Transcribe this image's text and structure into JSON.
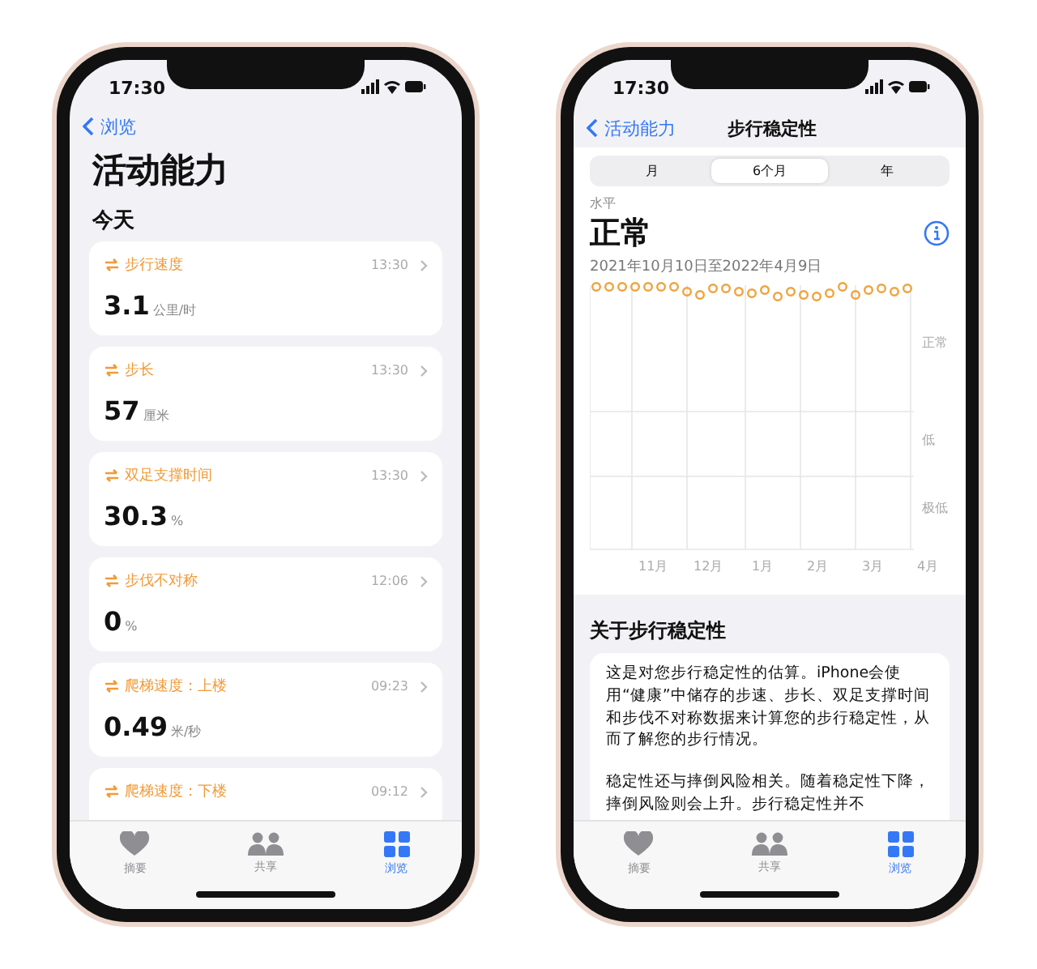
{
  "left_screen": {
    "status_bar": {
      "time": "17:30"
    },
    "back": "浏览",
    "title": "活动能力",
    "section": "今天",
    "cards": [
      {
        "label": "步行速度",
        "time": "13:30",
        "value": "3.1",
        "unit": "公里/时"
      },
      {
        "label": "步长",
        "time": "13:30",
        "value": "57",
        "unit": "厘米"
      },
      {
        "label": "双足支撑时间",
        "time": "13:30",
        "value": "30.3",
        "unit": "%"
      },
      {
        "label": "步伐不对称",
        "time": "12:06",
        "value": "0",
        "unit": "%"
      },
      {
        "label": "爬梯速度：上楼",
        "time": "09:23",
        "value": "0.49",
        "unit": "米/秒"
      },
      {
        "label": "爬梯速度：下楼",
        "time": "09:12"
      }
    ],
    "tab_bar": [
      {
        "label": "摘要",
        "kind": "heart",
        "selected": false
      },
      {
        "label": "共享",
        "kind": "people",
        "selected": false
      },
      {
        "label": "浏览",
        "kind": "grid",
        "selected": true
      }
    ]
  },
  "right_screen": {
    "status_bar": {
      "time": "17:30"
    },
    "back": "活动能力",
    "title": "步行稳定性",
    "segments": [
      {
        "label": "月",
        "selected": false
      },
      {
        "label": "6个月",
        "selected": true
      },
      {
        "label": "年",
        "selected": false
      }
    ],
    "caption": "水平",
    "level": "正常",
    "date_range": "2021年10月10日至2022年4月9日",
    "chart": {
      "y_labels": [
        "正常",
        "低",
        "极低"
      ],
      "x_labels": [
        "11月",
        "12月",
        "1月",
        "2月",
        "3月",
        "4月"
      ]
    },
    "about_title": "关于步行稳定性",
    "paragraphs": [
      "这是对您步行稳定性的估算。iPhone会使用“健康”中储存的步速、步长、双足支撑时间和步伐不对称数据来计算您的步行稳定性，从而了解您的步行情况。",
      "稳定性还与摔倒风险相关。随着稳定性下降，摔倒风险则会上升。步行稳定性并不"
    ],
    "tab_bar": [
      {
        "label": "摘要",
        "kind": "heart",
        "selected": false
      },
      {
        "label": "共享",
        "kind": "people",
        "selected": false
      },
      {
        "label": "浏览",
        "kind": "grid",
        "selected": true
      }
    ]
  }
}
